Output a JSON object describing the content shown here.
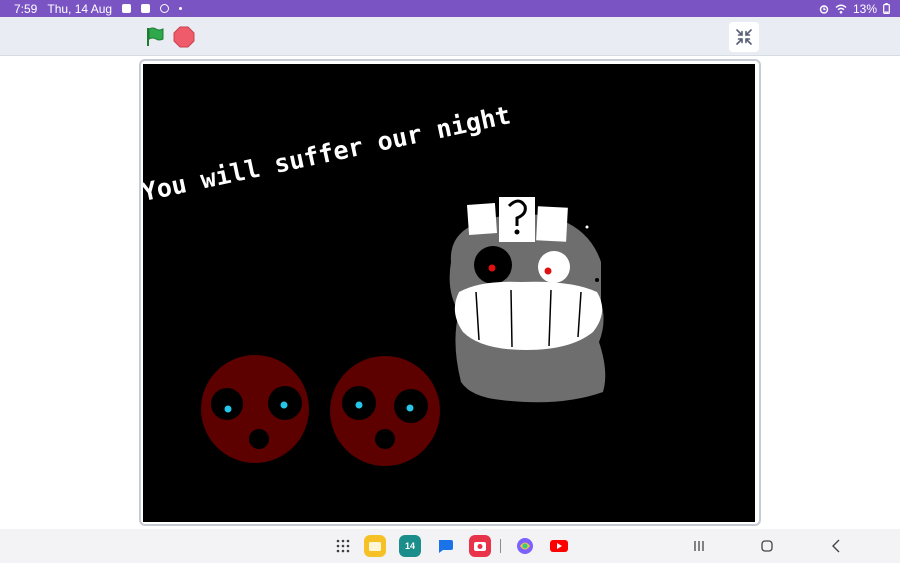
{
  "status_bar": {
    "time": "7:59",
    "date": "Thu, 14 Aug",
    "battery": "13%",
    "icons": [
      "battery-saver-icon",
      "check-icon",
      "whatsapp-icon",
      "alarm-icon",
      "wifi-icon",
      "battery-icon"
    ]
  },
  "toolbar": {
    "green_flag": "green-flag-icon",
    "stop": "stop-icon",
    "exit_fullscreen": "exit-fullscreen-icon"
  },
  "stage": {
    "text": "You will suffer our night",
    "background": "#000000"
  },
  "taskbar": {
    "calendar_day": "14",
    "apps": [
      "app-drawer-icon",
      "my-files-icon",
      "calendar-icon",
      "messages-icon",
      "camera-icon",
      "copilot-icon",
      "youtube-icon"
    ],
    "system_buttons": [
      "recent-apps-icon",
      "home-icon",
      "back-icon"
    ]
  },
  "colors": {
    "status_bar": "#7b54c4",
    "toolbar": "#e9edf3",
    "flag": "#2ea84a",
    "stop": "#ef5b6a"
  }
}
